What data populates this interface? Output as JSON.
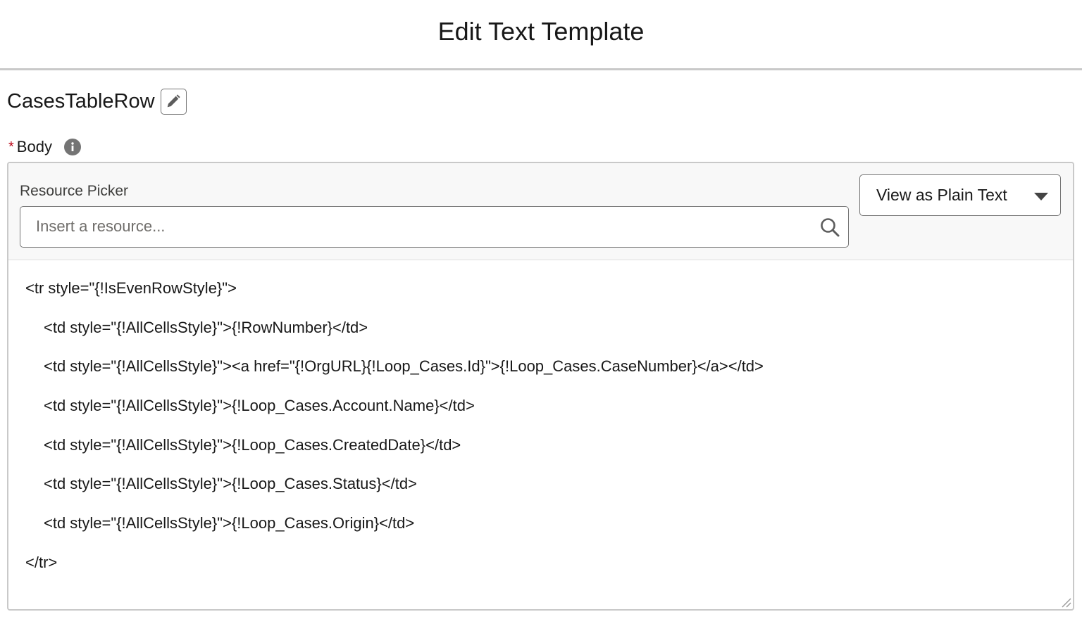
{
  "header": {
    "title": "Edit Text Template"
  },
  "resource": {
    "api_name": "CasesTableRow",
    "edit_icon": "pencil-icon"
  },
  "body_field": {
    "required_marker": "*",
    "label": "Body",
    "info_icon": "info-icon"
  },
  "toolbar": {
    "picker_label": "Resource Picker",
    "picker_placeholder": "Insert a resource...",
    "picker_value": "",
    "search_icon": "search-icon",
    "view_mode": "View as Plain Text",
    "view_mode_icon": "caret-down-icon"
  },
  "editor": {
    "lines": [
      {
        "text": "<tr style=\"{!IsEvenRowStyle}\">",
        "indent": false
      },
      {
        "text": "<td style=\"{!AllCellsStyle}\">{!RowNumber}</td>",
        "indent": true
      },
      {
        "text": "<td style=\"{!AllCellsStyle}\"><a href=\"{!OrgURL}{!Loop_Cases.Id}\">{!Loop_Cases.CaseNumber}</a></td>",
        "indent": true
      },
      {
        "text": "<td style=\"{!AllCellsStyle}\">{!Loop_Cases.Account.Name}</td>",
        "indent": true
      },
      {
        "text": "<td style=\"{!AllCellsStyle}\">{!Loop_Cases.CreatedDate}</td>",
        "indent": true
      },
      {
        "text": "<td style=\"{!AllCellsStyle}\">{!Loop_Cases.Status}</td>",
        "indent": true
      },
      {
        "text": "<td style=\"{!AllCellsStyle}\">{!Loop_Cases.Origin}</td>",
        "indent": true
      },
      {
        "text": "</tr>",
        "indent": false
      }
    ]
  },
  "colors": {
    "required": "#ba0517",
    "border": "#c9c9c9",
    "toolbar_bg": "#f8f8f8",
    "icon_gray": "#747474"
  }
}
